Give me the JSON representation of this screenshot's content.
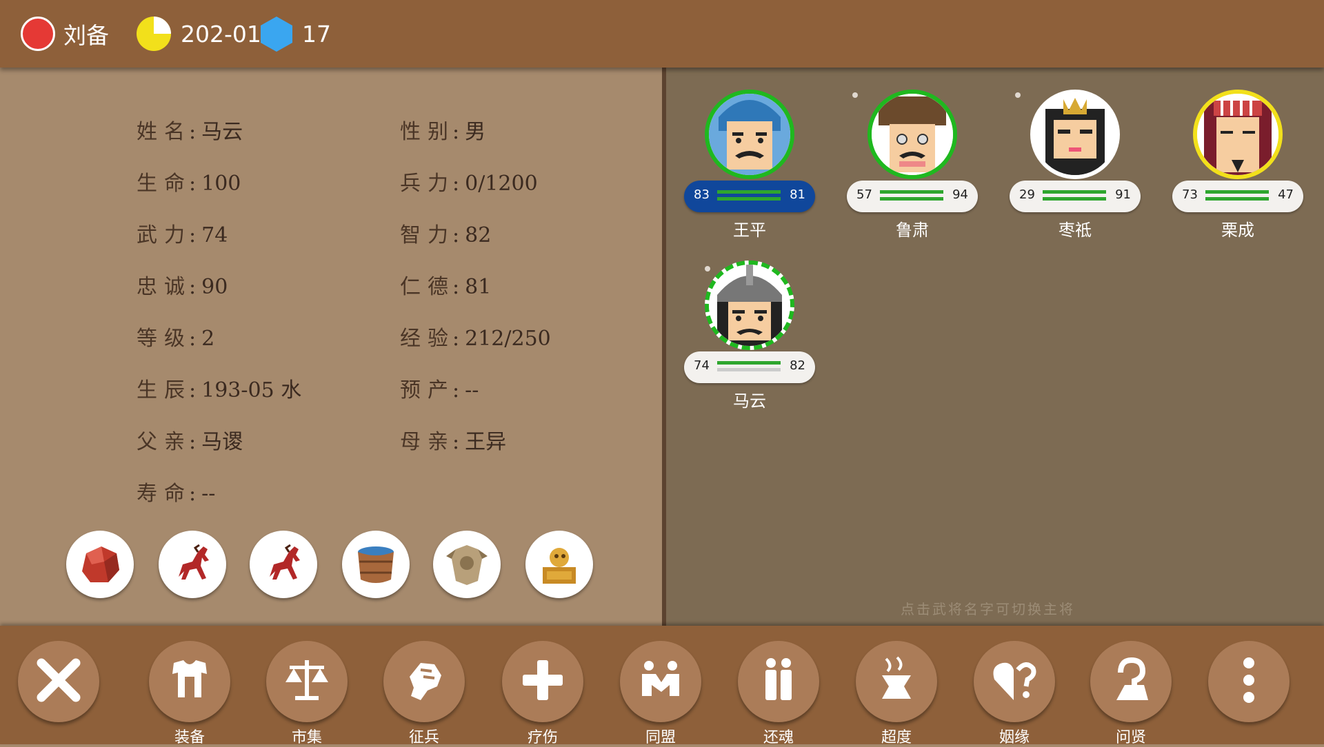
{
  "topbar": {
    "faction_name": "刘备",
    "date": "202-01",
    "gems": "17",
    "faction_color": "#e53935",
    "date_icon": "pie-clock-icon",
    "gem_icon": "hexagon-gem-icon"
  },
  "profile": {
    "rows": [
      {
        "left_label": "姓名",
        "left_value": "马云",
        "right_label": "性别",
        "right_value": "男"
      },
      {
        "left_label": "生命",
        "left_value": "100",
        "right_label": "兵力",
        "right_value": "0/1200"
      },
      {
        "left_label": "武力",
        "left_value": "74",
        "right_label": "智力",
        "right_value": "82"
      },
      {
        "left_label": "忠诚",
        "left_value": "90",
        "right_label": "仁德",
        "right_value": "81"
      },
      {
        "left_label": "等级",
        "left_value": "2",
        "right_label": "经验",
        "right_value": "212/250"
      },
      {
        "left_label": "生辰",
        "left_value": "193-05 水",
        "right_label": "预产",
        "right_value": "--"
      },
      {
        "left_label": "父亲",
        "left_value": "马谡",
        "right_label": "母亲",
        "right_value": "王异"
      },
      {
        "left_label": "寿命",
        "left_value": "--"
      }
    ],
    "items": [
      "red-gem-icon",
      "red-horse-icon",
      "red-horse-icon",
      "wooden-bucket-icon",
      "bronze-armor-icon",
      "golden-treasure-icon"
    ]
  },
  "generals": [
    {
      "name": "王平",
      "str": "83",
      "int": "81",
      "ring": "#1fb81f",
      "selected": true
    },
    {
      "name": "鲁肃",
      "str": "57",
      "int": "94",
      "ring": "#1fb81f",
      "selected": false
    },
    {
      "name": "枣祗",
      "str": "29",
      "int": "91",
      "ring": "#ffffff",
      "selected": false
    },
    {
      "name": "栗成",
      "str": "73",
      "int": "47",
      "ring": "#f2e01b",
      "selected": false
    },
    {
      "name": "马云",
      "str": "74",
      "int": "82",
      "ring": "#1fb81f",
      "selected": false
    }
  ],
  "hint": "点击武将名字可切换主将",
  "actions": [
    {
      "label": "",
      "icon": "close-icon"
    },
    {
      "label": "装备",
      "icon": "armor-icon"
    },
    {
      "label": "市集",
      "icon": "scales-icon"
    },
    {
      "label": "征兵",
      "icon": "fist-icon"
    },
    {
      "label": "疗伤",
      "icon": "plus-icon"
    },
    {
      "label": "同盟",
      "icon": "handshake-icon"
    },
    {
      "label": "还魂",
      "icon": "two-people-icon"
    },
    {
      "label": "超度",
      "icon": "incense-icon"
    },
    {
      "label": "姻缘",
      "icon": "heart-question-icon"
    },
    {
      "label": "问贤",
      "icon": "sage-question-icon"
    },
    {
      "label": "",
      "icon": "more-icon"
    }
  ]
}
